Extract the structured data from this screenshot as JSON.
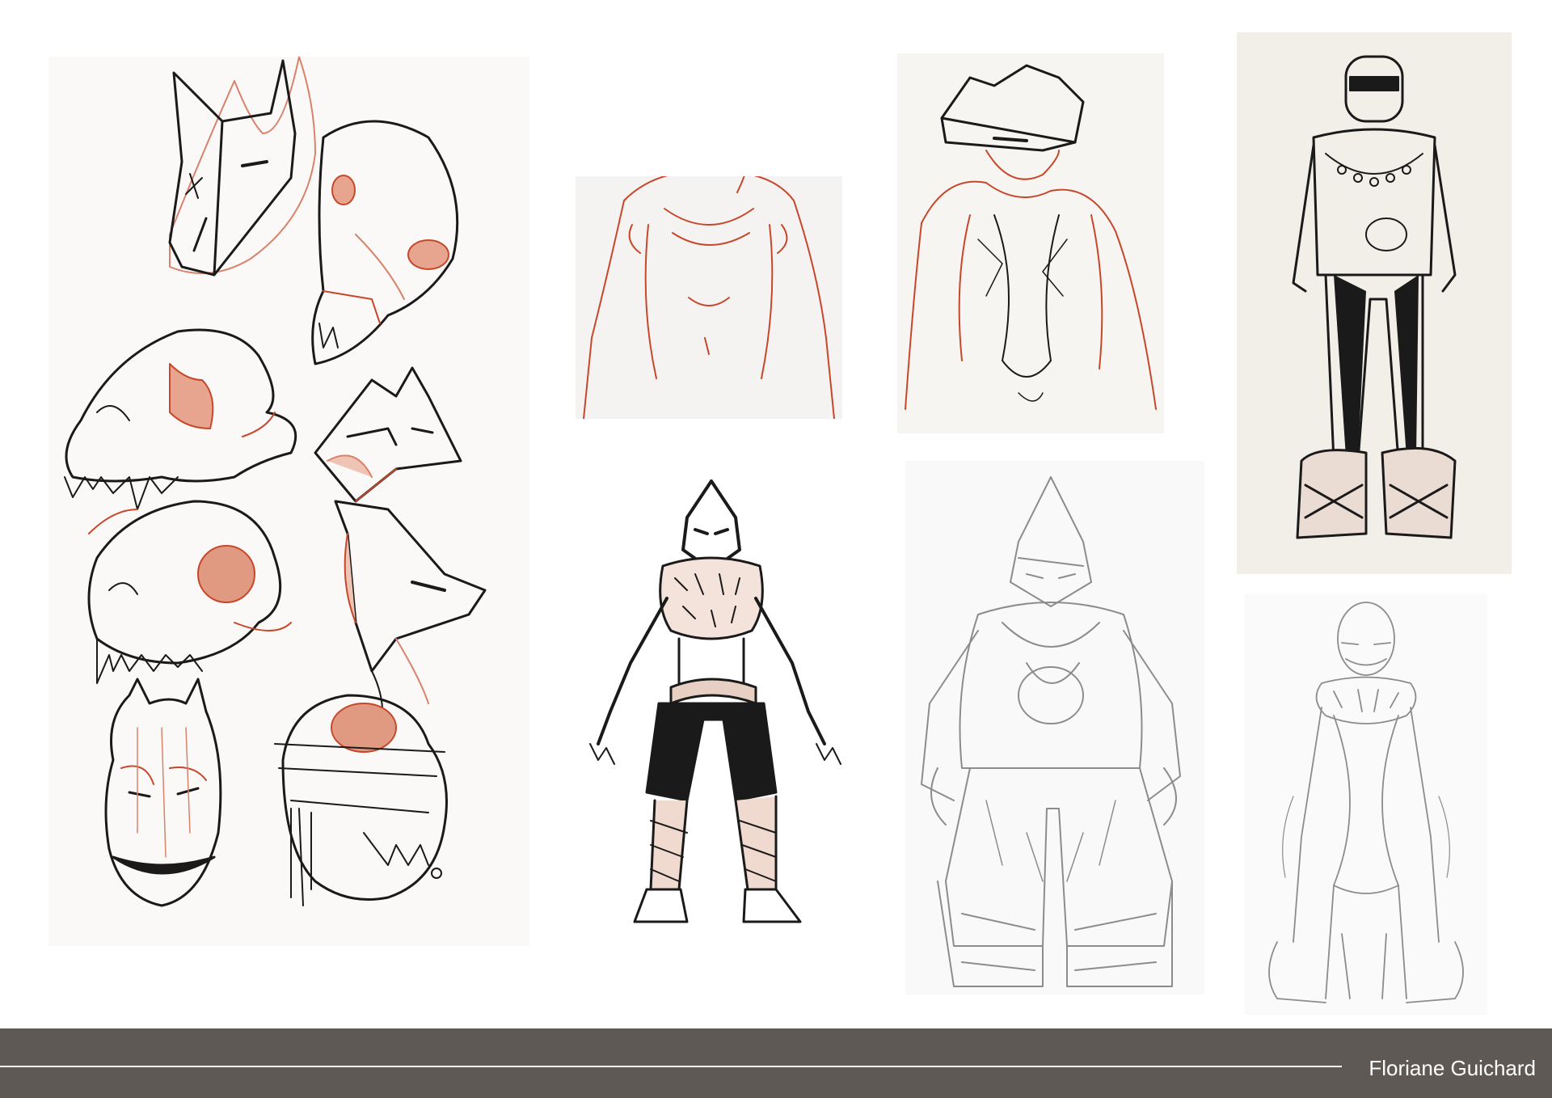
{
  "footer": {
    "credit": "Floriane Guichard"
  },
  "colors": {
    "sketch_red": "#c7472a",
    "ink": "#1a1a1a",
    "graphite": "#8c8c8c",
    "footer_bg": "#5e5955"
  },
  "illustrations": [
    {
      "subject": "fox-mask-front"
    },
    {
      "subject": "canine-skull-top"
    },
    {
      "subject": "canine-skull-side"
    },
    {
      "subject": "fox-mask-angled"
    },
    {
      "subject": "cat-skull-side"
    },
    {
      "subject": "fox-mask-profile"
    },
    {
      "subject": "kitsune-mask"
    },
    {
      "subject": "wrapped-skull"
    },
    {
      "subject": "hooded-figure"
    },
    {
      "subject": "cloaked-figure-with-mask"
    },
    {
      "subject": "inked-standing-figure"
    },
    {
      "subject": "inked-crouching-warrior"
    },
    {
      "subject": "graphite-masked-figure"
    },
    {
      "subject": "graphite-standing-figure"
    }
  ]
}
